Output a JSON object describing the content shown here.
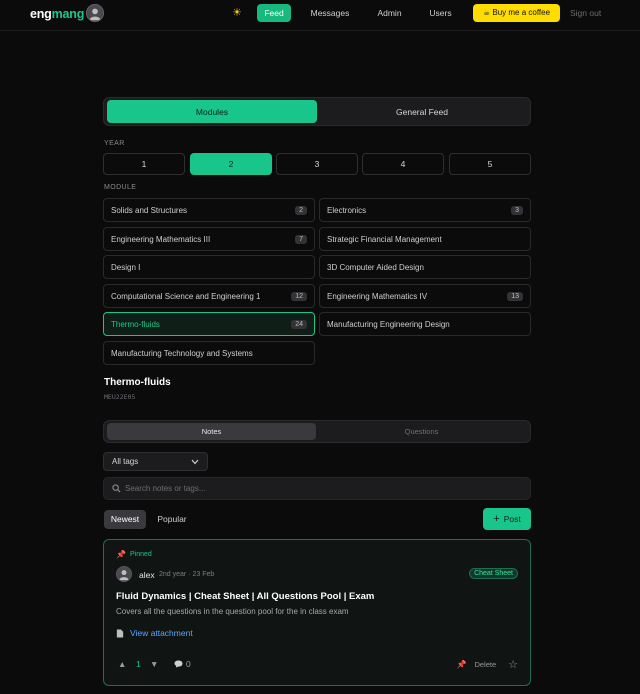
{
  "nav": {
    "logo_part1": "eng",
    "logo_part2": "mang",
    "theme_icon": "sun-icon",
    "links": [
      "Feed",
      "Messages",
      "Admin",
      "Users"
    ],
    "coffee_label": "☕ Buy me a coffee",
    "signout_label": "Sign out"
  },
  "colors": {
    "accent": "#18c58a",
    "coffee": "#ffdd00",
    "link": "#5aa7ff",
    "pin": "#e34b5a"
  },
  "feed_tabs": {
    "modules": "Modules",
    "general": "General Feed"
  },
  "year": {
    "label": "YEAR",
    "options": [
      "1",
      "2",
      "3",
      "4",
      "5"
    ],
    "selected": "2"
  },
  "module": {
    "label": "MODULE",
    "items": [
      {
        "name": "Solids and Structures",
        "count": "2"
      },
      {
        "name": "Electronics",
        "count": "3"
      },
      {
        "name": "Engineering Mathematics III",
        "count": "7"
      },
      {
        "name": "Strategic Financial Management",
        "count": ""
      },
      {
        "name": "Design I",
        "count": ""
      },
      {
        "name": "3D Computer Aided Design",
        "count": ""
      },
      {
        "name": "Computational Science and Engineering 1",
        "count": "12"
      },
      {
        "name": "Engineering Mathematics IV",
        "count": "13"
      },
      {
        "name": "Thermo-fluids",
        "count": "24"
      },
      {
        "name": "Manufacturing Engineering Design",
        "count": ""
      },
      {
        "name": "Manufacturing Technology and Systems",
        "count": ""
      }
    ],
    "selected": "Thermo-fluids"
  },
  "selected_module": {
    "title": "Thermo-fluids",
    "code": "MEU22E05"
  },
  "content_tabs": {
    "notes": "Notes",
    "questions": "Questions"
  },
  "filters": {
    "tag_select": "All tags",
    "search_placeholder": "Search notes or tags...",
    "sort_newest": "Newest",
    "sort_popular": "Popular",
    "post_label": "Post"
  },
  "post": {
    "pinned_label": "Pinned",
    "author": "alex",
    "meta": "2nd year · 23 Feb",
    "tag": "Cheat Sheet",
    "title": "Fluid Dynamics | Cheat Sheet | All Questions Pool | Exam",
    "description": "Covers all the questions in the question pool for the in class exam",
    "attachment_label": "View attachment",
    "score": "1",
    "comments": "0",
    "delete_label": "Delete"
  }
}
